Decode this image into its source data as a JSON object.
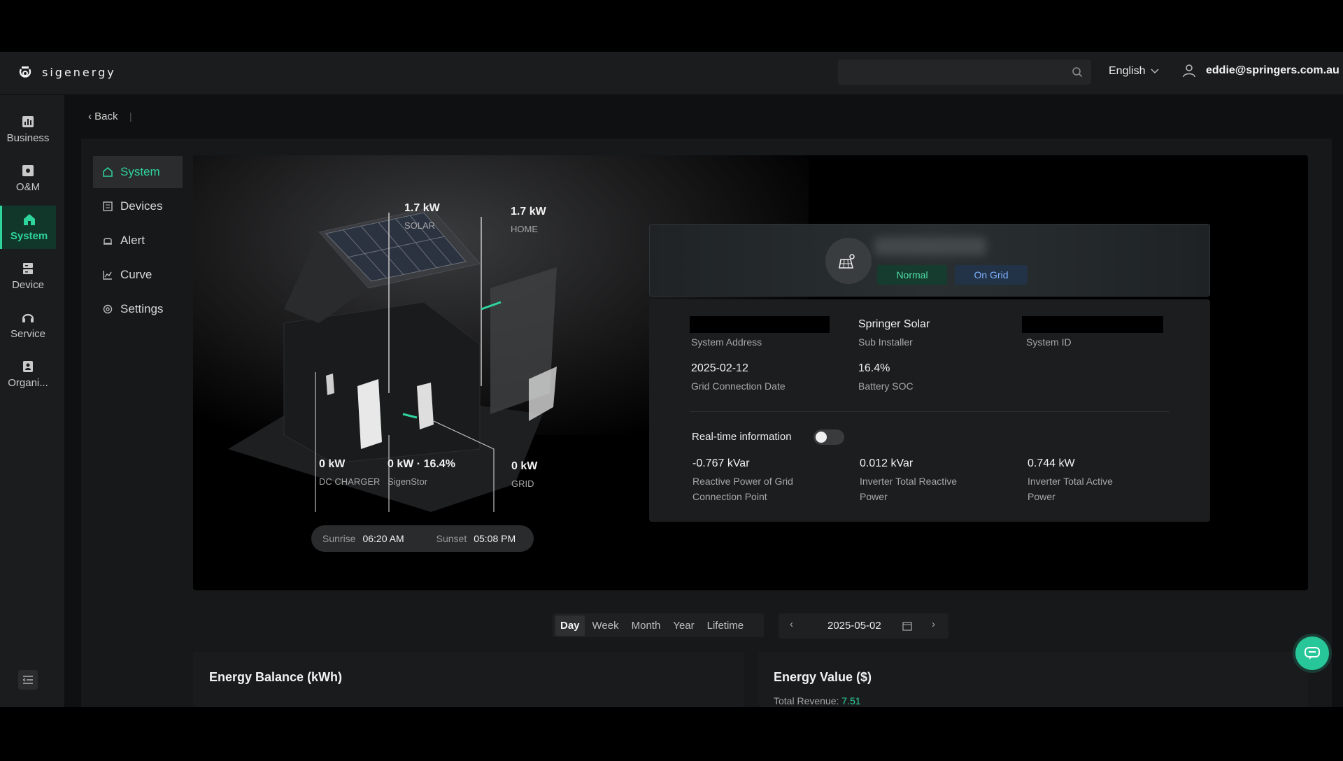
{
  "brand": {
    "name": "sigenergy"
  },
  "header": {
    "search_placeholder": "",
    "language": "English",
    "user_email": "eddie@springers.com.au"
  },
  "sidebar": {
    "items": [
      {
        "label": "Business",
        "icon": "bar-chart-icon"
      },
      {
        "label": "O&M",
        "icon": "wrench-icon"
      },
      {
        "label": "System",
        "icon": "home-icon",
        "active": true
      },
      {
        "label": "Device",
        "icon": "server-icon"
      },
      {
        "label": "Service",
        "icon": "headset-icon"
      },
      {
        "label": "Organi...",
        "icon": "id-card-icon"
      }
    ]
  },
  "nav": {
    "back_label": "Back"
  },
  "subnav": {
    "items": [
      {
        "label": "System",
        "active": true
      },
      {
        "label": "Devices"
      },
      {
        "label": "Alert"
      },
      {
        "label": "Curve"
      },
      {
        "label": "Settings"
      }
    ]
  },
  "energy_flow": {
    "solar": {
      "value": "1.7 kW",
      "label": "SOLAR"
    },
    "home": {
      "value": "1.7 kW",
      "label": "HOME"
    },
    "dc_charger": {
      "value": "0 kW",
      "label": "DC CHARGER"
    },
    "sigenstor": {
      "value": "0 kW · 16.4%",
      "label": "SigenStor"
    },
    "grid": {
      "value": "0 kW",
      "label": "GRID"
    },
    "sunrise_label": "Sunrise",
    "sunrise_time": "06:20 AM",
    "sunset_label": "Sunset",
    "sunset_time": "05:08 PM"
  },
  "system_card": {
    "status_badges": [
      "Normal",
      "On Grid"
    ],
    "fields": {
      "address_key": "System Address",
      "installer_value": "Springer Solar",
      "installer_key": "Sub Installer",
      "system_id_key": "System ID",
      "grid_date_value": "2025-02-12",
      "grid_date_key": "Grid Connection Date",
      "soc_value": "16.4%",
      "soc_key": "Battery SOC"
    },
    "realtime": {
      "label": "Real-time information",
      "enabled": false,
      "metrics": [
        {
          "value": "-0.767 kVar",
          "line1": "Reactive Power of Grid",
          "line2": "Connection Point"
        },
        {
          "value": "0.012 kVar",
          "line1": "Inverter Total Reactive",
          "line2": "Power"
        },
        {
          "value": "0.744 kW",
          "line1": "Inverter Total Active",
          "line2": "Power"
        }
      ]
    }
  },
  "period_selector": {
    "options": [
      "Day",
      "Week",
      "Month",
      "Year",
      "Lifetime"
    ],
    "selected": "Day",
    "date": "2025-05-02"
  },
  "cards": {
    "energy_balance_title": "Energy Balance (kWh)",
    "energy_value_title": "Energy Value ($)",
    "total_revenue_label": "Total Revenue:",
    "total_revenue_value": "7.51"
  },
  "colors": {
    "accent": "#2fd49c",
    "normal_badge_text": "#4fe0a9",
    "ongrid_badge_text": "#7fb1ff",
    "background": "#0f1011"
  }
}
